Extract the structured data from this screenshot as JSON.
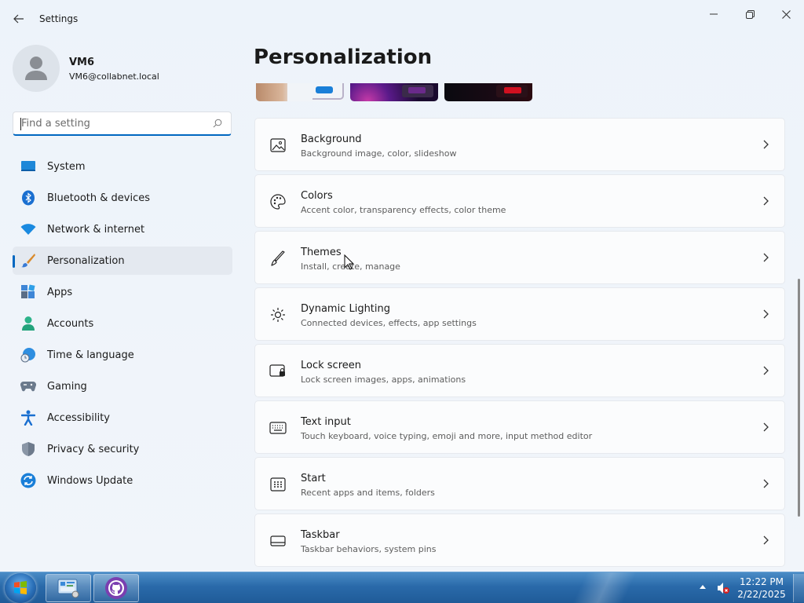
{
  "window": {
    "app_title": "Settings",
    "page_title": "Personalization"
  },
  "profile": {
    "name": "VM6",
    "email": "VM6@collabnet.local"
  },
  "search": {
    "placeholder": "Find a setting",
    "value": ""
  },
  "sidebar": {
    "items": [
      {
        "label": "System",
        "icon": "system-icon",
        "selected": false
      },
      {
        "label": "Bluetooth & devices",
        "icon": "bluetooth-icon",
        "selected": false
      },
      {
        "label": "Network & internet",
        "icon": "wifi-icon",
        "selected": false
      },
      {
        "label": "Personalization",
        "icon": "paintbrush-icon",
        "selected": true
      },
      {
        "label": "Apps",
        "icon": "apps-icon",
        "selected": false
      },
      {
        "label": "Accounts",
        "icon": "person-icon",
        "selected": false
      },
      {
        "label": "Time & language",
        "icon": "clock-globe-icon",
        "selected": false
      },
      {
        "label": "Gaming",
        "icon": "gamepad-icon",
        "selected": false
      },
      {
        "label": "Accessibility",
        "icon": "accessibility-icon",
        "selected": false
      },
      {
        "label": "Privacy & security",
        "icon": "shield-icon",
        "selected": false
      },
      {
        "label": "Windows Update",
        "icon": "update-icon",
        "selected": false
      }
    ]
  },
  "cards": [
    {
      "title": "Background",
      "desc": "Background image, color, slideshow",
      "icon": "image-icon"
    },
    {
      "title": "Colors",
      "desc": "Accent color, transparency effects, color theme",
      "icon": "palette-icon"
    },
    {
      "title": "Themes",
      "desc": "Install, create, manage",
      "icon": "brush-icon"
    },
    {
      "title": "Dynamic Lighting",
      "desc": "Connected devices, effects, app settings",
      "icon": "lighting-icon"
    },
    {
      "title": "Lock screen",
      "desc": "Lock screen images, apps, animations",
      "icon": "lock-screen-icon"
    },
    {
      "title": "Text input",
      "desc": "Touch keyboard, voice typing, emoji and more, input method editor",
      "icon": "keyboard-icon"
    },
    {
      "title": "Start",
      "desc": "Recent apps and items, folders",
      "icon": "start-icon"
    },
    {
      "title": "Taskbar",
      "desc": "Taskbar behaviors, system pins",
      "icon": "taskbar-icon"
    }
  ],
  "taskbar": {
    "time": "12:22 PM",
    "date": "2/22/2025"
  },
  "colors": {
    "accent": "#0067c0",
    "taskbar": "#2a6aaa"
  }
}
